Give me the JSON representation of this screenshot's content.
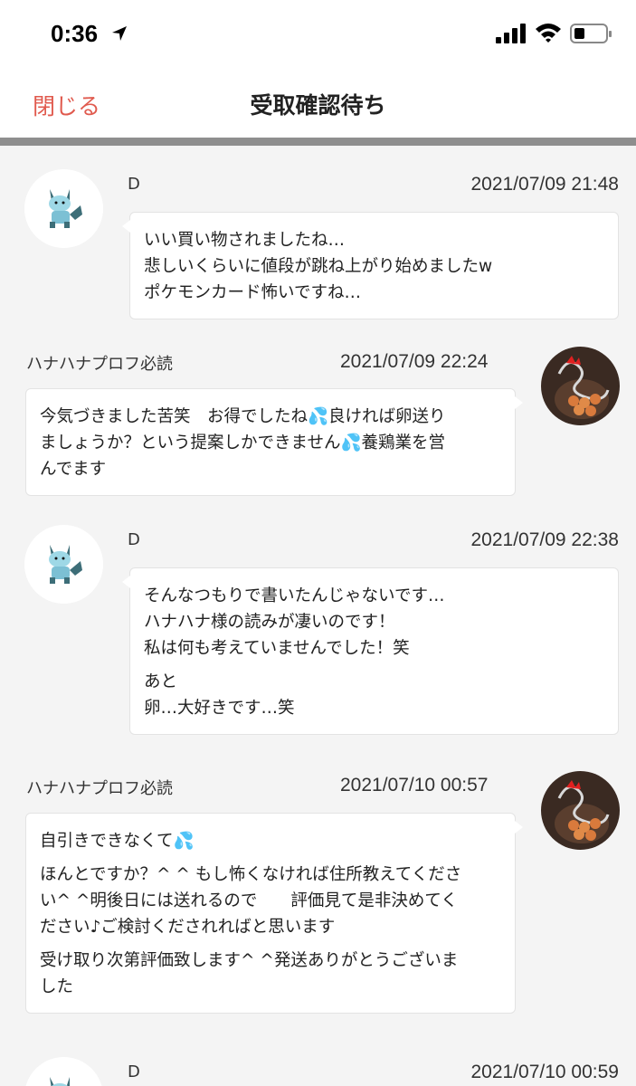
{
  "status_bar": {
    "time": "0:36"
  },
  "nav": {
    "close_label": "閉じる",
    "title": "受取確認待ち"
  },
  "messages": [
    {
      "sender": "D",
      "timestamp": "2021/07/09 21:48",
      "paragraphs": [
        "いい買い物されましたね…\n悲しいくらいに値段が跳ね上がり始めましたw\nポケモンカード怖いですね…"
      ]
    },
    {
      "sender": "ハナハナプロフ必読",
      "timestamp": "2021/07/09 22:24",
      "paragraphs": [
        "今気づきました苦笑　お得でしたね💦良ければ卵送り\nましょうか？という提案しかできません💦養鶏業を営\nんでます"
      ]
    },
    {
      "sender": "D",
      "timestamp": "2021/07/09 22:38",
      "paragraphs": [
        "そんなつもりで書いたんじゃないです…\nハナハナ様の読みが凄いのです！\n私は何も考えていませんでした！笑",
        "あと\n卵…大好きです…笑"
      ]
    },
    {
      "sender": "ハナハナプロフ必読",
      "timestamp": "2021/07/10 00:57",
      "paragraphs": [
        "自引きできなくて💦",
        "ほんとですか？^ ^ もし怖くなければ住所教えてくださ\nい^ ^明後日には送れるので　　評価見て是非決めてく\nださい♪ご検討くだされればと思います",
        "受け取り次第評価致します^ ^発送ありがとうございま\nした"
      ]
    },
    {
      "sender": "D",
      "timestamp": "2021/07/10 00:59"
    }
  ]
}
